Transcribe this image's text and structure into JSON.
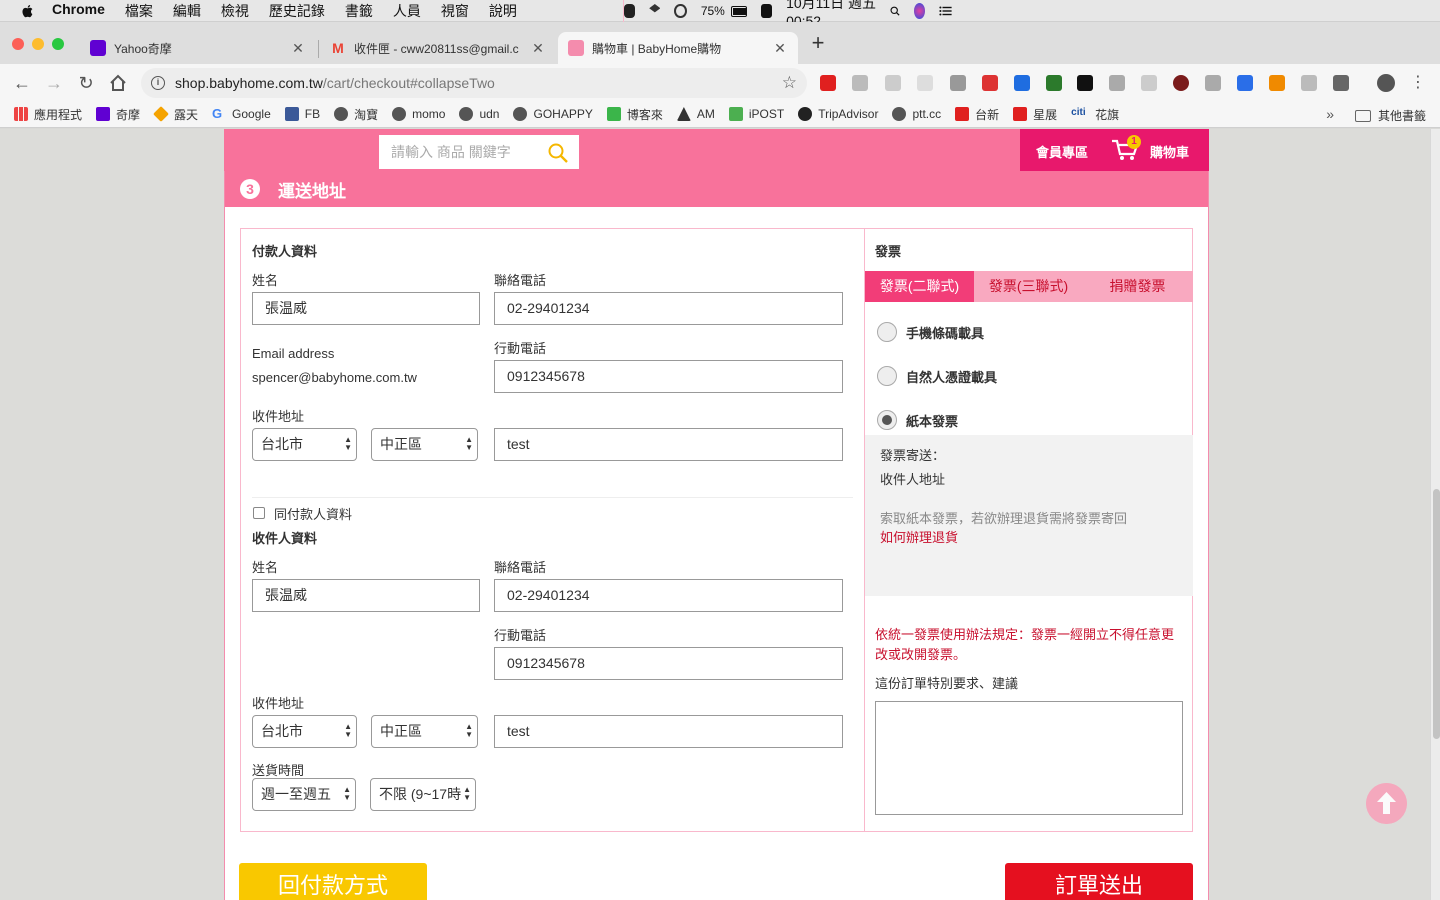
{
  "menubar": {
    "app": "Chrome",
    "items": [
      "檔案",
      "編輯",
      "檢視",
      "歷史記錄",
      "書籤",
      "人員",
      "視窗",
      "說明"
    ],
    "battery": "75%",
    "datetime": "10月11日 週五  00:52"
  },
  "tabs": [
    {
      "title": "Yahoo奇摩",
      "fav_color": "#6001d2",
      "active": false
    },
    {
      "title": "收件匣 - cww20811ss@gmail.c",
      "fav_color": "#ea4335",
      "active": false
    },
    {
      "title": "購物車 | BabyHome購物",
      "fav_color": "#f48cad",
      "active": true
    }
  ],
  "toolbar": {
    "url_host": "shop.babyhome.com.tw",
    "url_path": "/cart/checkout#collapseTwo"
  },
  "bookmarks": [
    "應用程式",
    "奇摩",
    "露天",
    "Google",
    "FB",
    "淘寶",
    "momo",
    "udn",
    "GOHAPPY",
    "博客來",
    "AM",
    "iPOST",
    "TripAdvisor",
    "ptt.cc",
    "台新",
    "星展",
    "花旗"
  ],
  "bookmarks_more": "»",
  "bookmarks_other": "其他書籤",
  "site": {
    "search_placeholder": "請輸入 商品 關鍵字",
    "member_link": "會員專區",
    "cart_count": "1",
    "cart_link": "購物車"
  },
  "step": {
    "number": "3",
    "title": "運送地址"
  },
  "payer": {
    "section_title": "付款人資料",
    "name_label": "姓名",
    "name_value": "張温威",
    "phone_label": "聯絡電話",
    "phone_value": "02-29401234",
    "email_label": "Email address",
    "email_value": "spencer@babyhome.com.tw",
    "mobile_label": "行動電話",
    "mobile_value": "0912345678",
    "address_label": "收件地址",
    "city": "台北市",
    "district": "中正區",
    "address_value": "test"
  },
  "receiver": {
    "same_label": "同付款人資料",
    "same_checked": false,
    "section_title": "收件人資料",
    "name_label": "姓名",
    "name_value": "張温威",
    "phone_label": "聯絡電話",
    "phone_value": "02-29401234",
    "mobile_label": "行動電話",
    "mobile_value": "0912345678",
    "address_label": "收件地址",
    "city": "台北市",
    "district": "中正區",
    "address_value": "test",
    "delivery_label": "送貨時間",
    "delivery_day": "週一至週五",
    "delivery_hour": "不限 (9~17時"
  },
  "invoice": {
    "title": "發票",
    "tabs": [
      "發票(二聯式)",
      "發票(三聯式)",
      "捐贈發票"
    ],
    "active_tab": 0,
    "options": [
      "手機條碼載具",
      "自然人憑證載具",
      "紙本發票"
    ],
    "selected_option": 2,
    "mail_label": "發票寄送：",
    "mail_value": "收件人地址",
    "return_note": "索取紙本發票，若欲辦理退貨需將發票寄回",
    "return_link": "如何辦理退貨",
    "law_note": "依統一發票使用辦法規定：發票一經開立不得任意更改或改開發票。",
    "remark_label": "這份訂單特別要求、建議",
    "remark_value": ""
  },
  "buttons": {
    "back": "回付款方式",
    "submit": "訂單送出"
  },
  "colors": {
    "brand_pink": "#f8729b",
    "brand_magenta": "#e8186c",
    "back_yellow": "#f9c800",
    "submit_red": "#e5101f"
  }
}
